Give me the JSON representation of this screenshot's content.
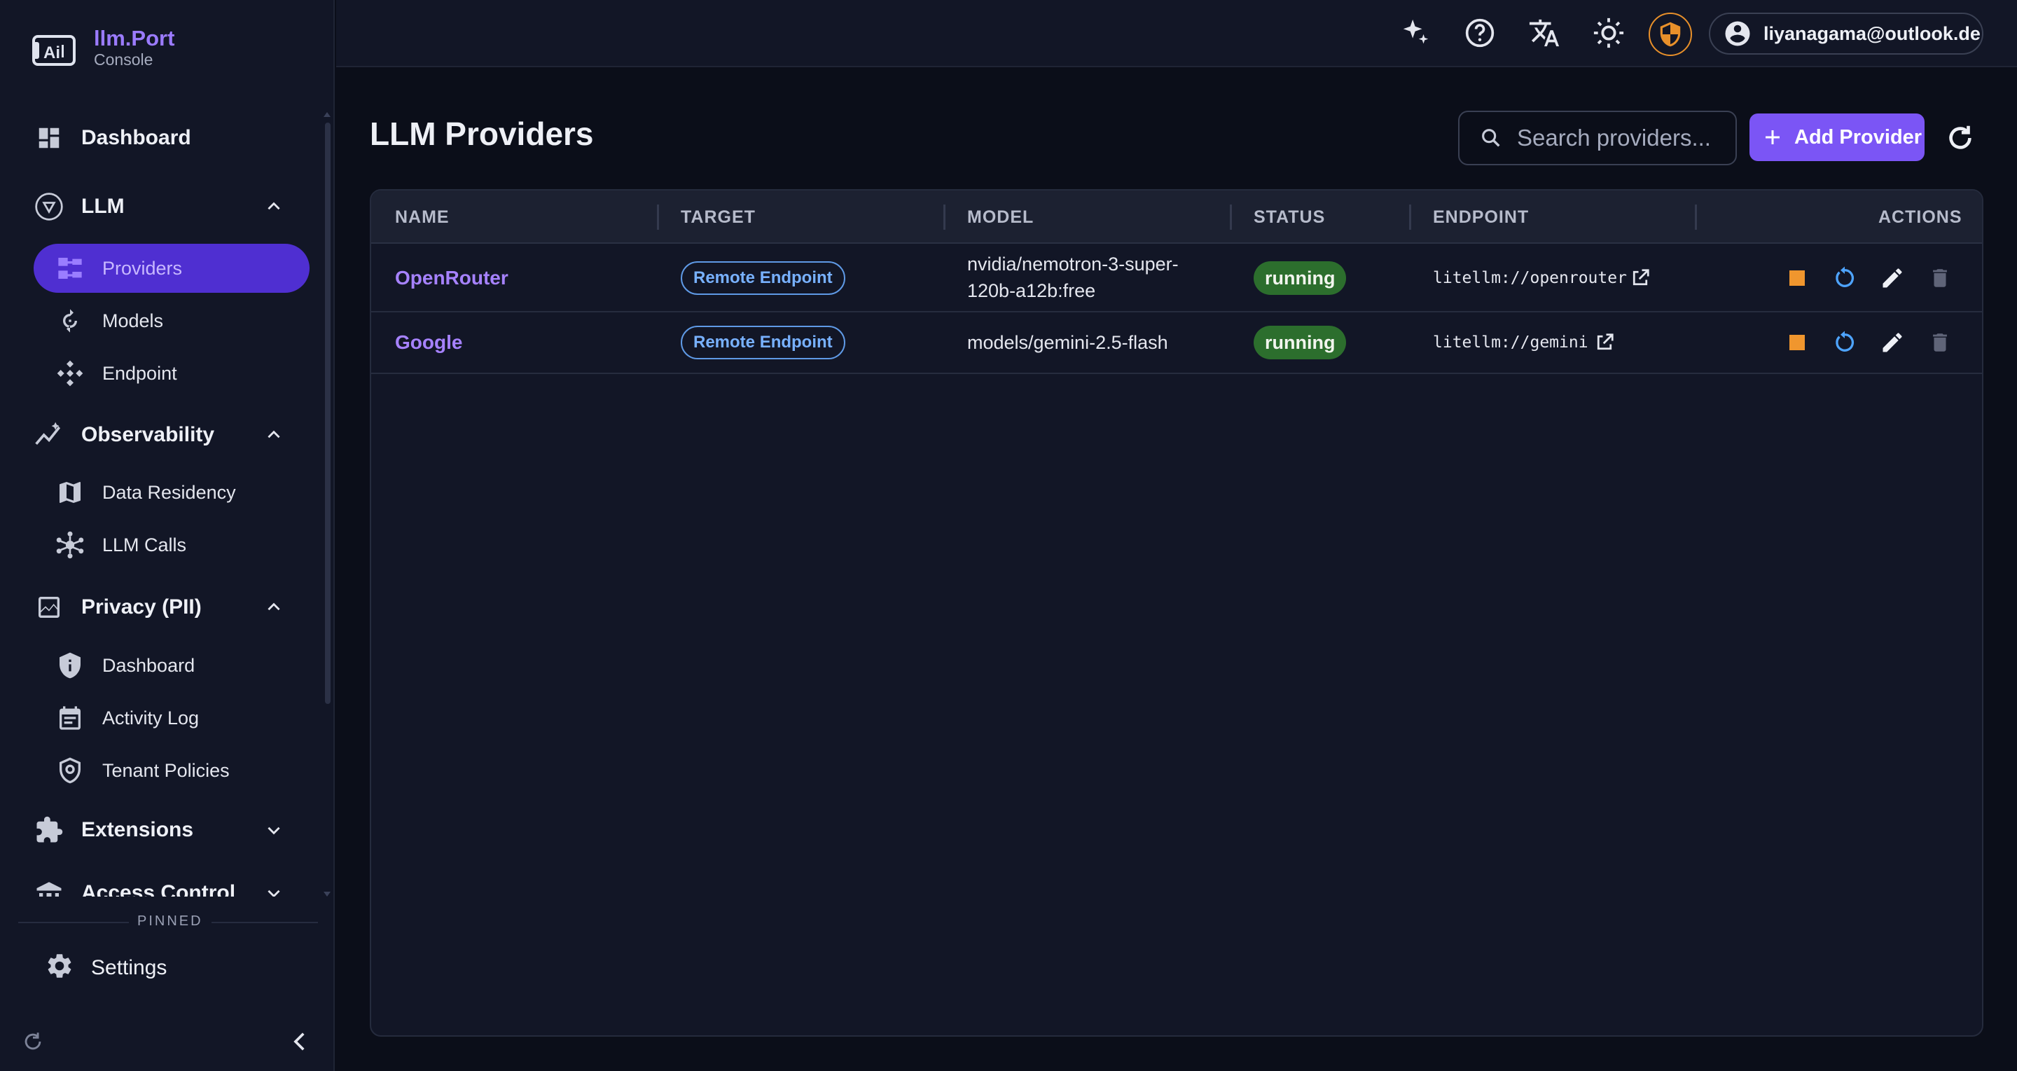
{
  "brand": {
    "name": "llm.Port",
    "subtitle": "Console"
  },
  "sidebar": {
    "items": [
      {
        "label": "Dashboard",
        "icon": "dashboard-icon"
      },
      {
        "label": "LLM",
        "icon": "llm-icon",
        "expanded": true
      },
      {
        "label": "Providers",
        "icon": "providers-icon",
        "active": true
      },
      {
        "label": "Models",
        "icon": "models-icon"
      },
      {
        "label": "Endpoint",
        "icon": "endpoint-icon"
      },
      {
        "label": "Observability",
        "icon": "observability-icon",
        "expanded": true
      },
      {
        "label": "Data Residency",
        "icon": "map-icon"
      },
      {
        "label": "LLM Calls",
        "icon": "hub-icon"
      },
      {
        "label": "Privacy (PII)",
        "icon": "privacy-chart-icon",
        "expanded": true
      },
      {
        "label": "Dashboard",
        "icon": "shield-info-icon"
      },
      {
        "label": "Activity Log",
        "icon": "calendar-icon"
      },
      {
        "label": "Tenant Policies",
        "icon": "shield-lock-icon"
      },
      {
        "label": "Extensions",
        "icon": "puzzle-icon",
        "expanded": false
      },
      {
        "label": "Access Control",
        "icon": "access-icon",
        "expanded": false
      }
    ],
    "pinned_label": "PINNED",
    "settings_label": "Settings"
  },
  "topbar": {
    "user_email": "liyanagama@outlook.de",
    "icons": [
      "sparkle-icon",
      "help-icon",
      "translate-icon",
      "theme-icon",
      "shield-icon",
      "account-icon"
    ]
  },
  "main": {
    "title": "LLM Providers",
    "search_placeholder": "Search providers...",
    "add_label": "Add Provider",
    "columns": [
      "NAME",
      "TARGET",
      "MODEL",
      "STATUS",
      "ENDPOINT",
      "ACTIONS"
    ],
    "rows": [
      {
        "name": "OpenRouter",
        "target": "Remote Endpoint",
        "model": "nvidia/nemotron-3-super-120b-a12b:free",
        "model_line1": "nvidia/nemotron-3-super-",
        "model_line2": "120b-a12b:free",
        "status": "running",
        "endpoint": "litellm://openrouter"
      },
      {
        "name": "Google",
        "target": "Remote Endpoint",
        "model": "models/gemini-2.5-flash",
        "status": "running",
        "endpoint": "litellm://gemini"
      }
    ]
  },
  "colors": {
    "accent": "#7b55f5",
    "active_nav": "#4f2fd1",
    "link": "#a682ff",
    "status_running": "#2c6e2d",
    "target_chip": "#78b1ff",
    "stop_action": "#f0962e",
    "restart_action": "#4ea4ff",
    "shield": "#e8902a"
  }
}
